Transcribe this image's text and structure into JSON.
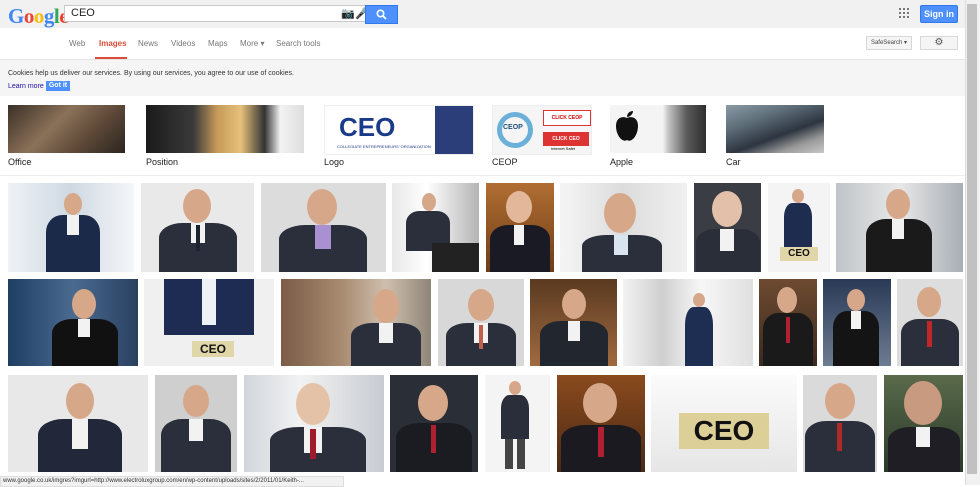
{
  "header": {
    "logo": "Google",
    "logo_colors": [
      "#4285f4",
      "#ea4335",
      "#fbbc05",
      "#4285f4",
      "#34a853",
      "#ea4335"
    ],
    "search_value": "CEO",
    "search_button_icon": "search-icon",
    "sign_in_label": "Sign in"
  },
  "nav": {
    "tabs": [
      {
        "label": "Web",
        "active": false
      },
      {
        "label": "Images",
        "active": true
      },
      {
        "label": "News",
        "active": false
      },
      {
        "label": "Videos",
        "active": false
      },
      {
        "label": "Maps",
        "active": false
      },
      {
        "label": "More ▾",
        "active": false
      },
      {
        "label": "Search tools",
        "active": false
      }
    ],
    "safesearch_label": "SafeSearch ▾",
    "settings_icon": "gear-icon"
  },
  "cookies": {
    "text": "Cookies help us deliver our services. By using our services, you agree to our use of cookies.",
    "learn_more": "Learn more",
    "got_it": "Got it"
  },
  "related": [
    {
      "label": "Office"
    },
    {
      "label": "Position"
    },
    {
      "label": "Logo"
    },
    {
      "label": "CEOP"
    },
    {
      "label": "Apple"
    },
    {
      "label": "Car"
    }
  ],
  "logo_tile": {
    "main": "CEO",
    "sub": "COLLEGIATE ENTREPRENEURS' ORGANIZATION"
  },
  "ceop_tile": {
    "text": "CEOP",
    "click": "CLICK CEOP",
    "click2": "CLICK CEO",
    "internet": "Internet Safet"
  },
  "ceo_signs": [
    "CEO",
    "CEO",
    "CEO"
  ],
  "status_url": "www.google.co.uk/imgres?imgurl=http://www.electroluxgroup.com/en/wp-content/uploads/sites/2/2011/01/Keith-..."
}
